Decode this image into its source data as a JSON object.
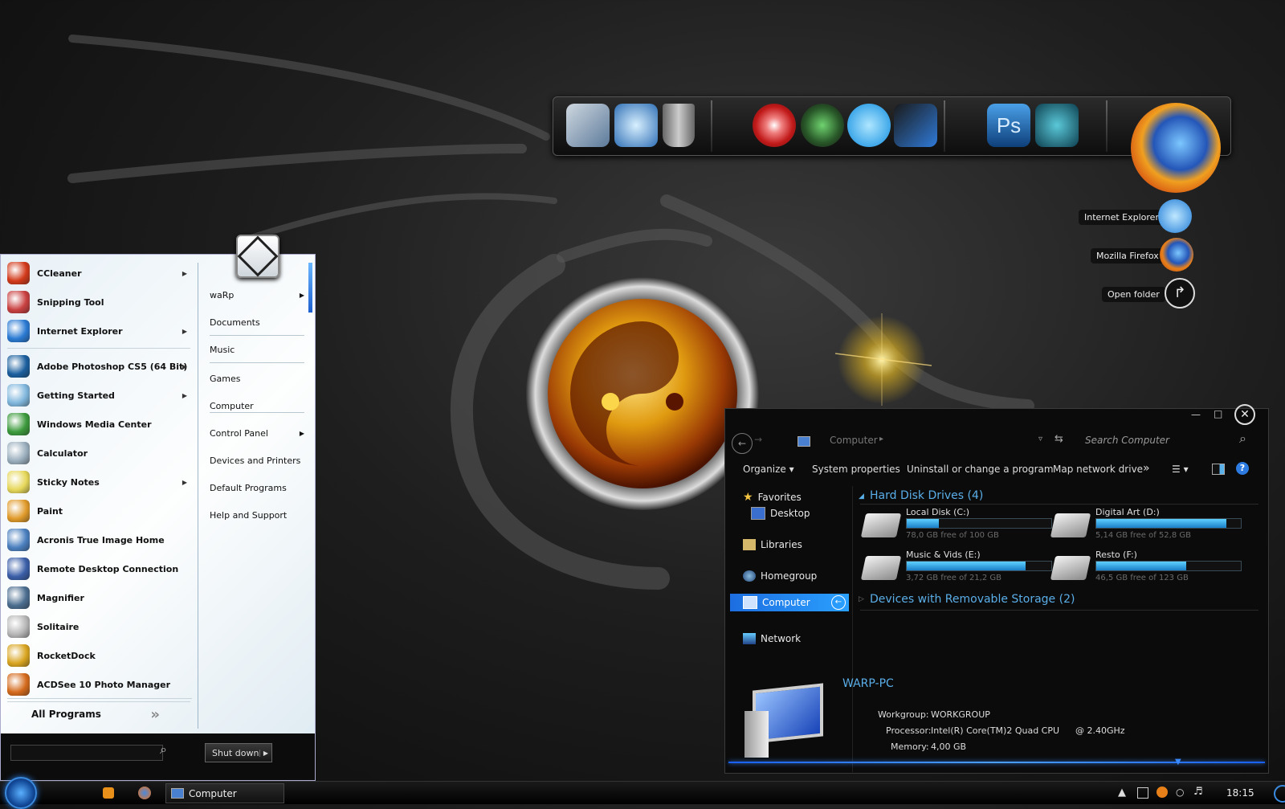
{
  "dock": {
    "icons": [
      "computer-icon",
      "network-icon",
      "recycle-bin-icon",
      "eye-icon",
      "utorrent-icon",
      "skype-icon",
      "folder-globe-icon",
      "photoshop-icon",
      "3ds-max-icon",
      "firefox-icon"
    ],
    "photoshop_text": "Ps"
  },
  "desktop_shortcuts": [
    {
      "label": "Internet Explorer",
      "icon": "internet-explorer-icon"
    },
    {
      "label": "Mozilla Firefox",
      "icon": "firefox-icon"
    },
    {
      "label": "Open folder",
      "icon": "open-folder-icon"
    }
  ],
  "start_menu": {
    "programs": [
      {
        "label": "CCleaner",
        "icon": "ccleaner-icon",
        "color": "#d23a1a",
        "arrow": true
      },
      {
        "label": "Snipping Tool",
        "icon": "scissors-icon",
        "color": "#c94040",
        "arrow": false
      },
      {
        "label": "Internet Explorer",
        "icon": "internet-explorer-icon",
        "color": "#2a7ad3",
        "arrow": true
      },
      {
        "label": "Adobe Photoshop CS5 (64 Bit)",
        "icon": "photoshop-icon",
        "color": "#1b5f9e",
        "arrow": true
      },
      {
        "label": "Getting Started",
        "icon": "getting-started-icon",
        "color": "#7fb6dc",
        "arrow": true
      },
      {
        "label": "Windows Media Center",
        "icon": "media-center-icon",
        "color": "#3c9a3c",
        "arrow": false
      },
      {
        "label": "Calculator",
        "icon": "calculator-icon",
        "color": "#9aaebd",
        "arrow": false
      },
      {
        "label": "Sticky Notes",
        "icon": "sticky-notes-icon",
        "color": "#e6d75a",
        "arrow": true
      },
      {
        "label": "Paint",
        "icon": "paint-icon",
        "color": "#e09a2a",
        "arrow": false
      },
      {
        "label": "Acronis True Image Home",
        "icon": "acronis-icon",
        "color": "#4a7fbf",
        "arrow": false
      },
      {
        "label": "Remote Desktop Connection",
        "icon": "remote-desktop-icon",
        "color": "#3a5ea8",
        "arrow": false
      },
      {
        "label": "Magnifier",
        "icon": "magnifier-icon",
        "color": "#4b6d8f",
        "arrow": false
      },
      {
        "label": "Solitaire",
        "icon": "solitaire-icon",
        "color": "#b6b6b6",
        "arrow": false
      },
      {
        "label": "RocketDock",
        "icon": "rocketdock-icon",
        "color": "#d9a520",
        "arrow": false
      },
      {
        "label": "ACDSee 10 Photo Manager",
        "icon": "acdsee-icon",
        "color": "#d46a1c",
        "arrow": false
      }
    ],
    "all_programs": "All Programs",
    "places": [
      {
        "label": "waRp",
        "arrow": true
      },
      {
        "label": "Documents",
        "arrow": false
      },
      {
        "label": "Music",
        "arrow": false
      },
      {
        "label": "Games",
        "arrow": false
      },
      {
        "label": "Computer",
        "arrow": false
      },
      {
        "label": "Control Panel",
        "arrow": true
      },
      {
        "label": "Devices and Printers",
        "arrow": false
      },
      {
        "label": "Default Programs",
        "arrow": false
      },
      {
        "label": "Help and Support",
        "arrow": false
      }
    ],
    "search_value": "",
    "shutdown_label": "Shut down"
  },
  "explorer": {
    "breadcrumb": "Computer",
    "search_placeholder": "Search Computer",
    "toolbar": {
      "organize": "Organize",
      "system_properties": "System properties",
      "uninstall": "Uninstall or change a program",
      "map_drive": "Map network drive"
    },
    "nav": {
      "favorites": "Favorites",
      "desktop": "Desktop",
      "libraries": "Libraries",
      "homegroup": "Homegroup",
      "computer": "Computer",
      "network": "Network"
    },
    "hdd_header": "Hard Disk Drives (4)",
    "removable_header": "Devices with Removable Storage (2)",
    "drives": [
      {
        "name": "Local Disk (C:)",
        "free": "78,0 GB free of 100 GB",
        "used_fraction": 0.22
      },
      {
        "name": "Digital Art (D:)",
        "free": "5,14 GB free of 52,8 GB",
        "used_fraction": 0.9
      },
      {
        "name": "Music & Vids (E:)",
        "free": "3,72 GB free of 21,2 GB",
        "used_fraction": 0.82
      },
      {
        "name": "Resto (F:)",
        "free": "46,5 GB free of 123 GB",
        "used_fraction": 0.62
      }
    ],
    "details": {
      "pc_name": "WARP-PC",
      "workgroup_label": "Workgroup:",
      "workgroup_value": "WORKGROUP",
      "processor_label": "Processor:",
      "processor_value": "Intel(R) Core(TM)2 Quad CPU",
      "processor_speed": "@ 2.40GHz",
      "memory_label": "Memory:",
      "memory_value": "4,00 GB"
    }
  },
  "taskbar": {
    "active_window": "Computer",
    "clock": "18:15"
  },
  "colors": {
    "accent": "#1e9be8",
    "explorer_bg": "#0b0b0b",
    "header_blue": "#5aaee8"
  }
}
